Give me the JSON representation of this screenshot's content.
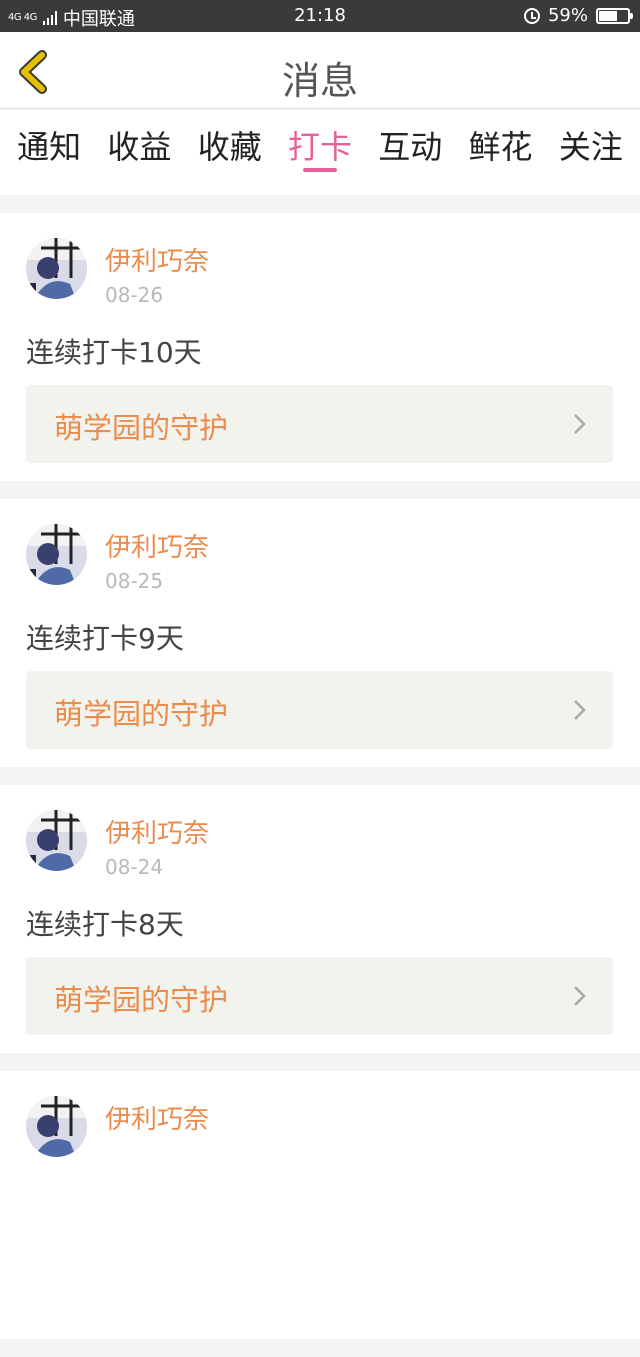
{
  "status_bar": {
    "network": "4G 4G",
    "carrier": "中国联通",
    "time": "21:18",
    "battery": "59%",
    "battery_level": 0.59,
    "icons": [
      "signal-icon",
      "alarm-icon",
      "battery-icon"
    ]
  },
  "header": {
    "title": "消息",
    "back_icon": "back-chevron-icon"
  },
  "tabs": [
    {
      "label": "通知",
      "active": false
    },
    {
      "label": "收益",
      "active": false
    },
    {
      "label": "收藏",
      "active": false
    },
    {
      "label": "打卡",
      "active": true
    },
    {
      "label": "互动",
      "active": false
    },
    {
      "label": "鲜花",
      "active": false
    },
    {
      "label": "关注",
      "active": false
    }
  ],
  "colors": {
    "accent": "#e8609a",
    "name": "#ea8c4e",
    "back_icon": "#e6c100"
  },
  "feed": [
    {
      "user": "伊利巧奈",
      "date": "08-26",
      "text": "连续打卡10天",
      "link": "萌学园的守护"
    },
    {
      "user": "伊利巧奈",
      "date": "08-25",
      "text": "连续打卡9天",
      "link": "萌学园的守护"
    },
    {
      "user": "伊利巧奈",
      "date": "08-24",
      "text": "连续打卡8天",
      "link": "萌学园的守护"
    },
    {
      "user": "伊利巧奈",
      "date": "",
      "text": "",
      "link": ""
    }
  ]
}
